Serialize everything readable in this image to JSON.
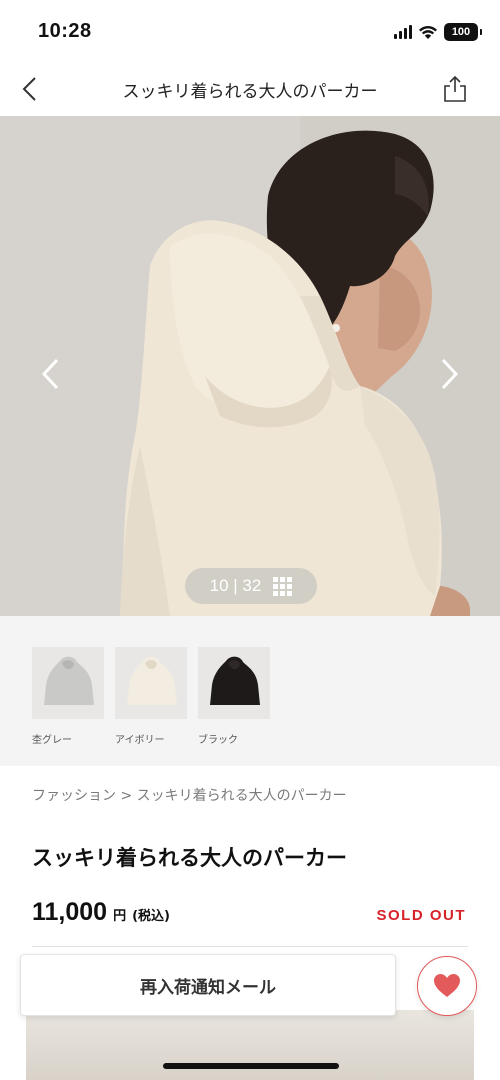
{
  "status_bar": {
    "time": "10:28",
    "battery": "100"
  },
  "nav": {
    "title": "スッキリ着られる大人のパーカー",
    "back_icon": "chevron-left-icon",
    "share_icon": "share-icon"
  },
  "gallery": {
    "counter": "10 | 32",
    "grid_icon": "grid-icon",
    "current_index": 10,
    "total": 32
  },
  "colors": [
    {
      "label": "杢グレー",
      "swatch": "#c9c9c7"
    },
    {
      "label": "アイボリー",
      "swatch": "#f3ece0"
    },
    {
      "label": "ブラック",
      "swatch": "#1e1a1a"
    }
  ],
  "breadcrumb": "ファッション > スッキリ着られる大人のパーカー",
  "product": {
    "title": "スッキリ着られる大人のパーカー",
    "price": "11,000",
    "currency": "円",
    "tax_note": "(税込)",
    "stock_status": "SOLD OUT"
  },
  "actions": {
    "notify_label": "再入荷通知メール",
    "favorite_icon": "heart-icon"
  },
  "theme": {
    "accent_red": "#d7222a",
    "heart_red": "#e25a5a"
  }
}
